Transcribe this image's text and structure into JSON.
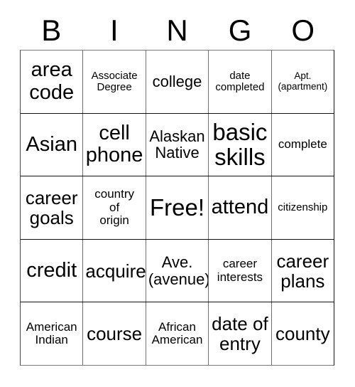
{
  "card": {
    "header_letters": [
      "B",
      "I",
      "N",
      "G",
      "O"
    ],
    "free_space_label": "Free!",
    "rows": [
      [
        {
          "text": "area\ncode",
          "size": "fs-xl"
        },
        {
          "text": "Associate\nDegree",
          "size": "fs-xs"
        },
        {
          "text": "college",
          "size": "fs-md"
        },
        {
          "text": "date\ncompleted",
          "size": "fs-xs"
        },
        {
          "text": "Apt.\n(apartment)",
          "size": "fs-xxs"
        }
      ],
      [
        {
          "text": "Asian",
          "size": "fs-xl"
        },
        {
          "text": "cell\nphone",
          "size": "fs-xl"
        },
        {
          "text": "Alaskan\nNative",
          "size": "fs-md"
        },
        {
          "text": "basic\nskills",
          "size": "fs-xxl"
        },
        {
          "text": "complete",
          "size": "fs-sm"
        }
      ],
      [
        {
          "text": "career\ngoals",
          "size": "fs-lg"
        },
        {
          "text": "country\nof\norigin",
          "size": "fs-sm"
        },
        {
          "text": "Free!",
          "size": "fs-xxl"
        },
        {
          "text": "attend",
          "size": "fs-xl"
        },
        {
          "text": "citizenship",
          "size": "fs-xs"
        }
      ],
      [
        {
          "text": "credit",
          "size": "fs-xl"
        },
        {
          "text": "acquire",
          "size": "fs-lg"
        },
        {
          "text": "Ave.\n(avenue)",
          "size": "fs-md"
        },
        {
          "text": "career\ninterests",
          "size": "fs-sm"
        },
        {
          "text": "career\nplans",
          "size": "fs-lg"
        }
      ],
      [
        {
          "text": "American\nIndian",
          "size": "fs-sm"
        },
        {
          "text": "course",
          "size": "fs-lg"
        },
        {
          "text": "African\nAmerican",
          "size": "fs-sm"
        },
        {
          "text": "date of\nentry",
          "size": "fs-lg"
        },
        {
          "text": "county",
          "size": "fs-lg"
        }
      ]
    ]
  },
  "colors": {
    "background": "#ffffff",
    "text": "#000000",
    "grid_line": "#111111"
  }
}
